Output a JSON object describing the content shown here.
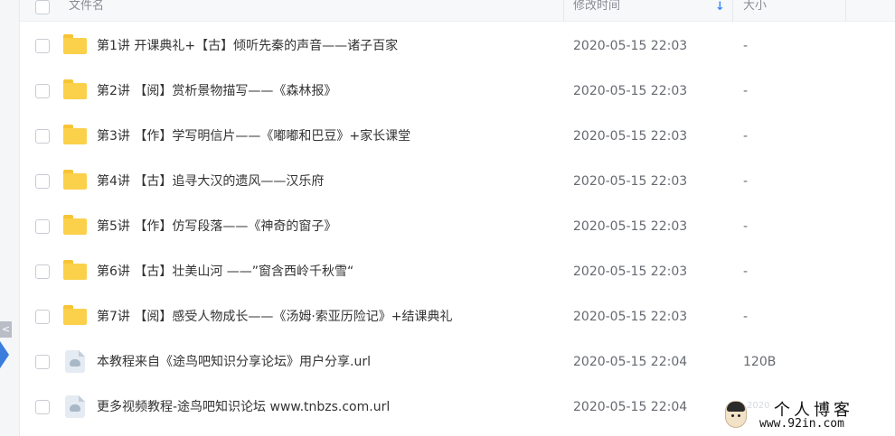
{
  "header": {
    "col_name": "文件名",
    "col_modified": "修改时间",
    "col_size": "大小",
    "sort_icon": "arrow-down-icon"
  },
  "sidebar": {
    "collapse_glyph": "<"
  },
  "rows": [
    {
      "name": "第1讲 开课典礼+【古】倾听先秦的声音——诸子百家",
      "time": "2020-05-15 22:03",
      "size": "-",
      "type": "folder"
    },
    {
      "name": "第2讲 【阅】赏析景物描写——《森林报》",
      "time": "2020-05-15 22:03",
      "size": "-",
      "type": "folder"
    },
    {
      "name": "第3讲 【作】学写明信片——《嘟嘟和巴豆》+家长课堂",
      "time": "2020-05-15 22:03",
      "size": "-",
      "type": "folder"
    },
    {
      "name": "第4讲 【古】追寻大汉的遗风——汉乐府",
      "time": "2020-05-15 22:03",
      "size": "-",
      "type": "folder"
    },
    {
      "name": "第5讲 【作】仿写段落——《神奇的窗子》",
      "time": "2020-05-15 22:03",
      "size": "-",
      "type": "folder"
    },
    {
      "name": "第6讲 【古】壮美山河 ——”窗含西岭千秋雪“",
      "time": "2020-05-15 22:03",
      "size": "-",
      "type": "folder"
    },
    {
      "name": "第7讲 【阅】感受人物成长——《汤姆·索亚历险记》+结课典礼",
      "time": "2020-05-15 22:03",
      "size": "-",
      "type": "folder"
    },
    {
      "name": "本教程来自《途鸟吧知识分享论坛》用户分享.url",
      "time": "2020-05-15 22:04",
      "size": "120B",
      "type": "file"
    },
    {
      "name": "更多视频教程-途鸟吧知识论坛 www.tnbzs.com.url",
      "time": "2020-05-15 22:04",
      "size": "",
      "type": "file"
    }
  ],
  "watermark": {
    "title": "个人博客",
    "url": "www.92in.com",
    "faded": "2020"
  },
  "colors": {
    "accent": "#3b8cf5",
    "folder": "#fbd04a",
    "text": "#333333",
    "muted": "#666a70"
  }
}
